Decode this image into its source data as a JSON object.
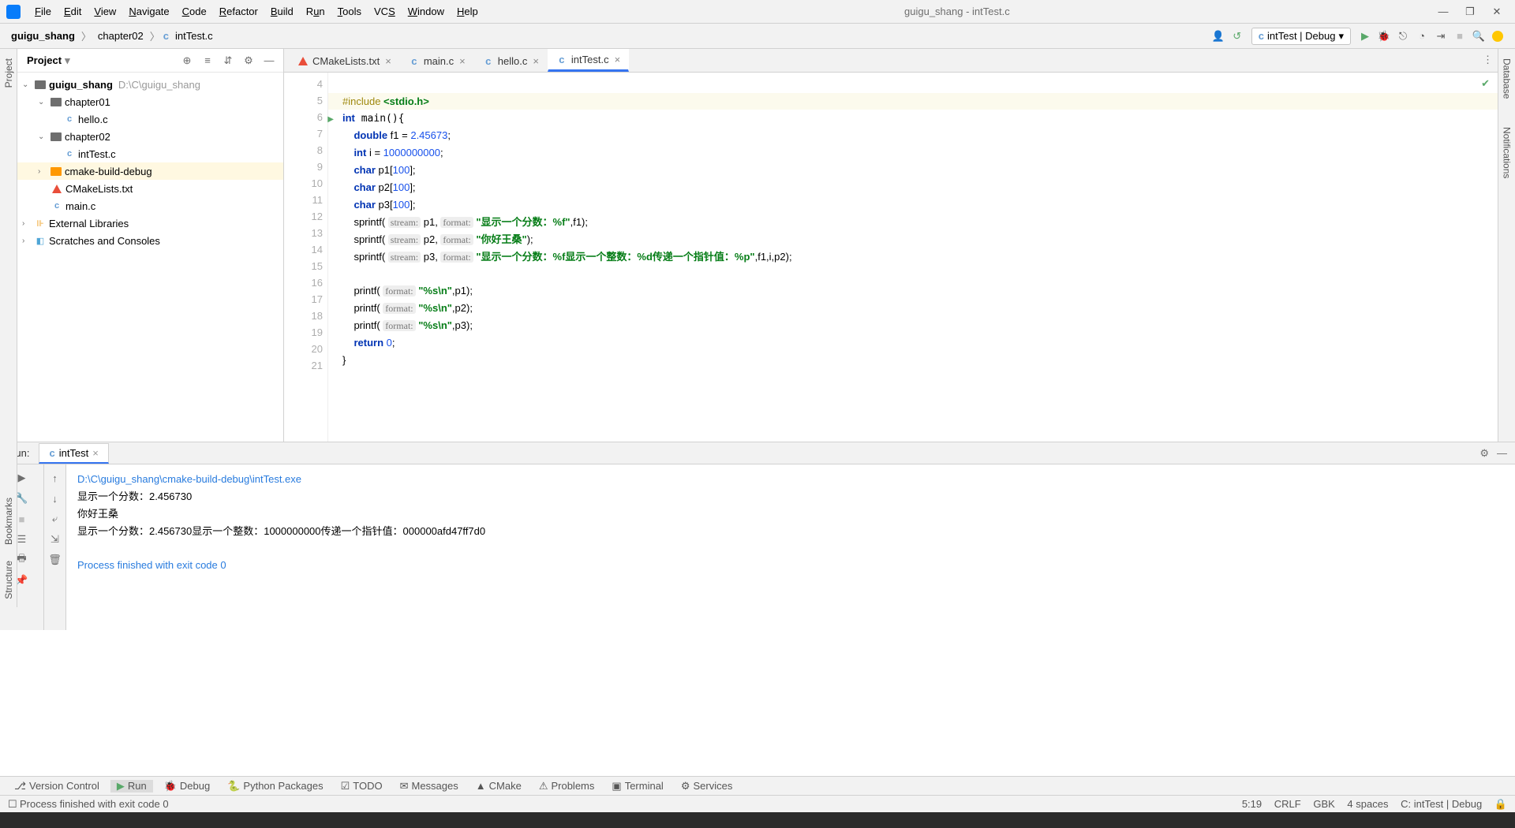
{
  "menu": {
    "items": [
      "File",
      "Edit",
      "View",
      "Navigate",
      "Code",
      "Refactor",
      "Build",
      "Run",
      "Tools",
      "VCS",
      "Window",
      "Help"
    ],
    "title": "guigu_shang - intTest.c"
  },
  "breadcrumbs": [
    "guigu_shang",
    "chapter02",
    "intTest.c"
  ],
  "runConfig": "intTest | Debug",
  "project": {
    "title": "Project",
    "root": {
      "name": "guigu_shang",
      "path": "D:\\C\\guigu_shang"
    },
    "ch1": "chapter01",
    "ch1f": "hello.c",
    "ch2": "chapter02",
    "ch2f": "intTest.c",
    "cbd": "cmake-build-debug",
    "cml": "CMakeLists.txt",
    "mc": "main.c",
    "ext": "External Libraries",
    "scr": "Scratches and Consoles"
  },
  "tabs": [
    {
      "label": "CMakeLists.txt",
      "icon": "cmake"
    },
    {
      "label": "main.c",
      "icon": "c"
    },
    {
      "label": "hello.c",
      "icon": "c"
    },
    {
      "label": "intTest.c",
      "icon": "c",
      "active": true
    }
  ],
  "code": {
    "lines": [
      4,
      5,
      6,
      7,
      8,
      9,
      10,
      11,
      12,
      13,
      14,
      15,
      16,
      17,
      18,
      19,
      20,
      21
    ],
    "l5_inc": "#include ",
    "l5_hdr": "<stdio.h>",
    "l6": "int main(){",
    "l7a": "    double",
    "l7b": " f1 = ",
    "l7c": "2.45673",
    "l7d": ";",
    "l8a": "    int",
    "l8b": " i = ",
    "l8c": "1000000000",
    "l8d": ";",
    "l9a": "    char",
    "l9b": " p1[",
    "l9c": "100",
    "l9d": "];",
    "l10a": "    char",
    "l10b": " p2[",
    "l10c": "100",
    "l10d": "];",
    "l11a": "    char",
    "l11b": " p3[",
    "l11c": "100",
    "l11d": "];",
    "l12a": "    sprintf( ",
    "l12h1": "stream:",
    "l12b": " p1, ",
    "l12h2": "format:",
    "l12c": " ",
    "l12s": "\"显示一个分数：%f\"",
    "l12d": ",f1);",
    "l13a": "    sprintf( ",
    "l13h1": "stream:",
    "l13b": " p2, ",
    "l13h2": "format:",
    "l13c": " ",
    "l13s": "\"你好王桑\"",
    "l13d": ");",
    "l14a": "    sprintf( ",
    "l14h1": "stream:",
    "l14b": " p3, ",
    "l14h2": "format:",
    "l14c": " ",
    "l14s": "\"显示一个分数：%f显示一个整数：%d传递一个指针值：%p\"",
    "l14d": ",f1,i,p2);",
    "l16a": "    printf( ",
    "l16h": "format:",
    "l16b": " ",
    "l16s": "\"%s\\n\"",
    "l16c": ",p1);",
    "l17a": "    printf( ",
    "l17h": "format:",
    "l17b": " ",
    "l17s": "\"%s\\n\"",
    "l17c": ",p2);",
    "l18a": "    printf( ",
    "l18h": "format:",
    "l18b": " ",
    "l18s": "\"%s\\n\"",
    "l18c": ",p3);",
    "l19a": "    return ",
    "l19b": "0",
    "l19c": ";",
    "l20": "}"
  },
  "run": {
    "label": "Run:",
    "tab": "intTest",
    "out_path": "D:\\C\\guigu_shang\\cmake-build-debug\\intTest.exe",
    "out1": "显示一个分数：2.456730",
    "out2": "你好王桑",
    "out3": "显示一个分数：2.456730显示一个整数：1000000000传递一个指针值：000000afd47ff7d0",
    "out4": "Process finished with exit code 0"
  },
  "bottomTabs": [
    "Version Control",
    "Run",
    "Debug",
    "Python Packages",
    "TODO",
    "Messages",
    "CMake",
    "Problems",
    "Terminal",
    "Services"
  ],
  "status": {
    "msg": "Process finished with exit code 0",
    "pos": "5:19",
    "eol": "CRLF",
    "enc": "GBK",
    "indent": "4 spaces",
    "ctx": "C: intTest | Debug"
  },
  "sideLeft": [
    "Project",
    "Bookmarks",
    "Structure"
  ],
  "sideRight": [
    "Database",
    "Notifications"
  ]
}
